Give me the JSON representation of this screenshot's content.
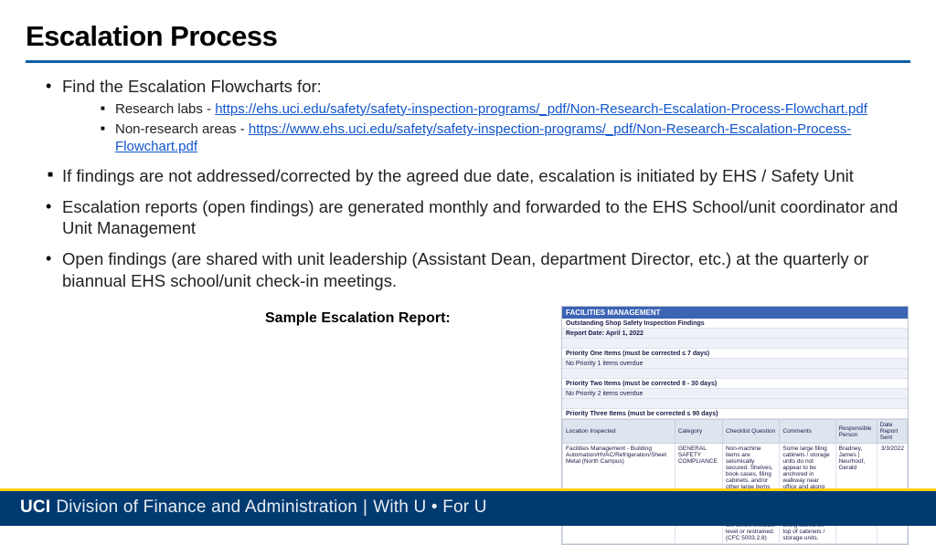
{
  "title": "Escalation Process",
  "bullets": {
    "b0": "Find the Escalation Flowcharts for:",
    "b0_sub0_prefix": "Research labs - ",
    "b0_sub0_link": "https://ehs.uci.edu/safety/safety-inspection-programs/_pdf/Non-Research-Escalation-Process-Flowchart.pdf",
    "b0_sub1_prefix": "Non-research areas - ",
    "b0_sub1_link": "https://www.ehs.uci.edu/safety/safety-inspection-programs/_pdf/Non-Research-Escalation-Process-Flowchart.pdf",
    "b1": "If findings are not addressed/corrected by the agreed due date, escalation is initiated by EHS / Safety Unit",
    "b2": "Escalation reports (open findings) are generated monthly and forwarded to the EHS School/unit coordinator and Unit Management",
    "b3": "Open findings (are shared with unit leadership (Assistant Dean, department Director, etc.) at the quarterly or biannual EHS school/unit check-in meetings."
  },
  "sample_label": "Sample Escalation Report:",
  "report": {
    "header": "FACILITIES MANAGEMENT",
    "subtitle": "Outstanding Shop Safety Inspection Findings",
    "date_label": "Report Date:  April 1, 2022",
    "p1_title": "Priority One Items (must be corrected ≤ 7 days)",
    "p1_row": "No Priority 1 items overdue",
    "p2_title": "Priority Two Items (must be corrected 8 - 30 days)",
    "p2_row": "No Priority 2 items overdue",
    "p3_title": "Priority Three Items (must be corrected ≤ 90 days)",
    "cols": {
      "c0": "Location Inspected",
      "c1": "Category",
      "c2": "Checklist Question",
      "c3": "Comments",
      "c4": "Responsible Person",
      "c5": "Date Report Sent"
    },
    "data": {
      "d0": "Facilities Management - Building Automation/HVAC/Refrigeration/Sheet Metal (North Campus)",
      "d1": "GENERAL SAFETY COMPLIANCE",
      "d2": "Non-machine items are seismically secured. Shelves, book cases, filing cabinets, and/or other large items are secured from moving, tipping, or potentially blocking exits. All unsecured items are below shoulder level or restrained. (CFC 5003.2.8)",
      "d3": "Some large filing cabinets / storage units do not appear to be anchored in walkway near office and along back wall where equipment is located. Large and potentially heavy materials are being stored on top of cabinets / storage units.",
      "d4": "Bradney, James | Neurhoof, Gerald",
      "d5": "3/3/2022"
    }
  },
  "footer": {
    "uci": "UCI",
    "division": "Division of Finance and Administration",
    "tagline": "With U • For U"
  }
}
